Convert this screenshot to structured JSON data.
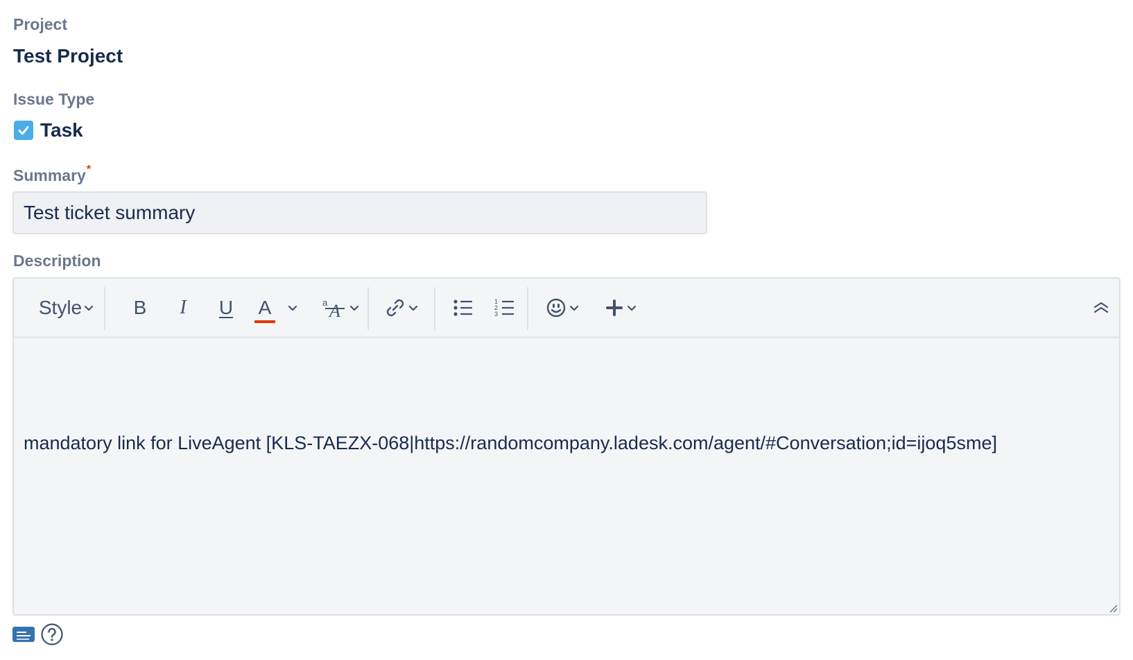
{
  "project": {
    "label": "Project",
    "value": "Test Project"
  },
  "issue_type": {
    "label": "Issue Type",
    "value": "Task",
    "icon": "checkbox-icon",
    "icon_color": "#4bade8"
  },
  "summary": {
    "label": "Summary",
    "required_marker": "*",
    "value": "Test ticket summary"
  },
  "description": {
    "label": "Description",
    "toolbar": {
      "style_label": "Style",
      "bold_label": "B",
      "italic_label": "I",
      "underline_label": "U",
      "text_color_label": "A",
      "text_color_underline": "#de350b",
      "icons": [
        "chevron-down-icon",
        "text-effects-icon",
        "link-icon",
        "bullet-list-icon",
        "numbered-list-icon",
        "emoji-icon",
        "plus-icon",
        "collapse-toolbar-icon"
      ]
    },
    "content": "mandatory link for LiveAgent [KLS-TAEZX-068|https://randomcompany.ladesk.com/agent/#Conversation;id=ijoq5sme]"
  },
  "footer": {
    "icons": [
      "wiki-markup-icon",
      "help-icon"
    ],
    "wiki_icon_color": "#3572b0"
  }
}
